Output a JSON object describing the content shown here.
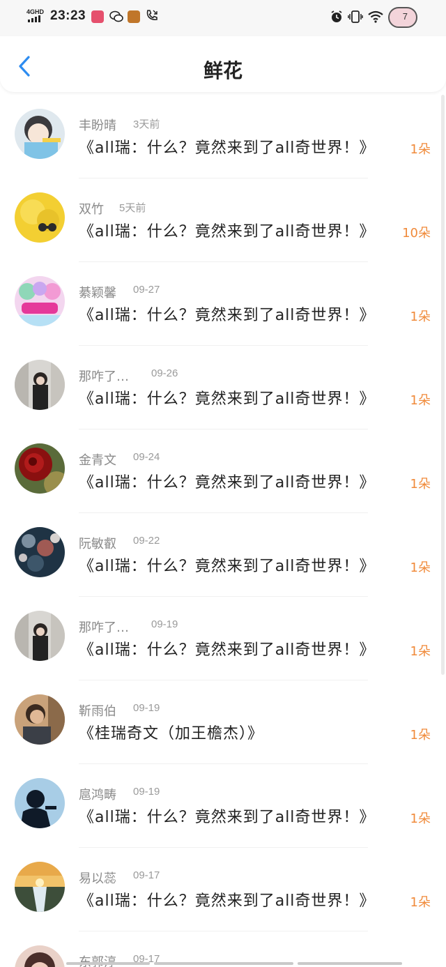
{
  "status_bar": {
    "network": "4GHD",
    "time": "23:23",
    "battery_level": "7"
  },
  "header": {
    "title": "鲜花"
  },
  "items": [
    {
      "name": "丰盼晴",
      "time": "3天前",
      "book": "《all瑞：什么？竟然来到了all奇世界！》",
      "count": "1朵"
    },
    {
      "name": "双竹",
      "time": "5天前",
      "book": "《all瑞：什么？竟然来到了all奇世界！》",
      "count": "10朵"
    },
    {
      "name": "綦颖馨",
      "time": "09-27",
      "book": "《all瑞：什么？竟然来到了all奇世界！》",
      "count": "1朵"
    },
    {
      "name": "那咋了…",
      "time": "09-26",
      "book": "《all瑞：什么？竟然来到了all奇世界！》",
      "count": "1朵"
    },
    {
      "name": "金青文",
      "time": "09-24",
      "book": "《all瑞：什么？竟然来到了all奇世界！》",
      "count": "1朵"
    },
    {
      "name": "阮敏叡",
      "time": "09-22",
      "book": "《all瑞：什么？竟然来到了all奇世界！》",
      "count": "1朵"
    },
    {
      "name": "那咋了…",
      "time": "09-19",
      "book": "《all瑞：什么？竟然来到了all奇世界！》",
      "count": "1朵"
    },
    {
      "name": "靳雨伯",
      "time": "09-19",
      "book": "《桂瑞奇文（加王檐杰）》",
      "count": "1朵"
    },
    {
      "name": "扈鸿畴",
      "time": "09-19",
      "book": "《all瑞：什么？竟然来到了all奇世界！》",
      "count": "1朵"
    },
    {
      "name": "易以蕊",
      "time": "09-17",
      "book": "《all瑞：什么？竟然来到了all奇世界！》",
      "count": "1朵"
    },
    {
      "name": "东郭淳",
      "time": "09-17",
      "book": "",
      "count": ""
    }
  ],
  "colors": {
    "accent_blue": "#2d8cf0",
    "count_orange": "#f08a3a",
    "meta_gray": "#8a8a8a"
  }
}
